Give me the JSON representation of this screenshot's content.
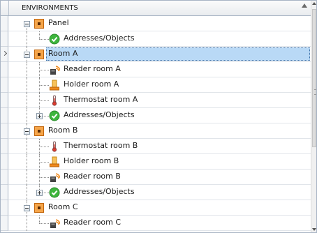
{
  "header": {
    "title": "ENVIRONMENTS"
  },
  "rows": [
    {
      "label": "Panel",
      "level": 0,
      "icon": "orange-square-icon",
      "expander": "minus"
    },
    {
      "label": "Addresses/Objects",
      "level": 1,
      "icon": "green-check-icon"
    },
    {
      "label": "Room A",
      "level": 0,
      "icon": "orange-square-icon",
      "expander": "minus",
      "selected": true,
      "current": true
    },
    {
      "label": "Reader room A",
      "level": 1,
      "icon": "card-reader-icon"
    },
    {
      "label": "Holder room A",
      "level": 1,
      "icon": "card-holder-icon"
    },
    {
      "label": "Thermostat room A",
      "level": 1,
      "icon": "thermometer-icon"
    },
    {
      "label": "Addresses/Objects",
      "level": 1,
      "icon": "green-check-icon",
      "expander": "plus"
    },
    {
      "label": "Room B",
      "level": 0,
      "icon": "orange-square-icon",
      "expander": "minus"
    },
    {
      "label": "Thermostat room B",
      "level": 1,
      "icon": "thermometer-icon"
    },
    {
      "label": "Holder room B",
      "level": 1,
      "icon": "card-holder-icon"
    },
    {
      "label": "Reader room B",
      "level": 1,
      "icon": "card-reader-icon"
    },
    {
      "label": "Addresses/Objects",
      "level": 1,
      "icon": "green-check-icon",
      "expander": "plus"
    },
    {
      "label": "Room C",
      "level": 0,
      "icon": "orange-square-icon",
      "expander": "minus"
    },
    {
      "label": "Reader room C",
      "level": 1,
      "icon": "card-reader-icon"
    }
  ],
  "colors": {
    "selection": "#b9d9f6",
    "accent_orange": "#f08a1c",
    "check_green": "#3db53d"
  }
}
